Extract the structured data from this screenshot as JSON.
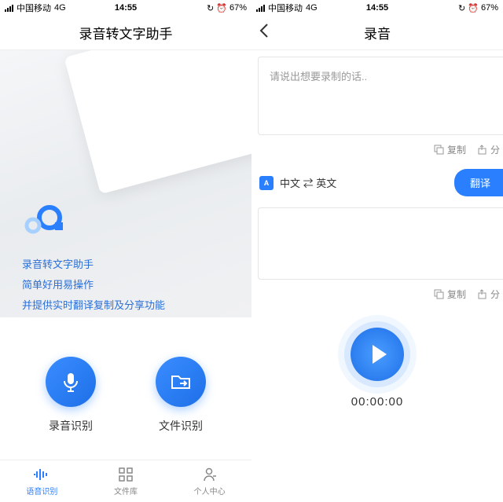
{
  "status": {
    "carrier": "中国移动",
    "network": "4G",
    "time": "14:55",
    "battery": "67%"
  },
  "screen1": {
    "title": "录音转文字助手",
    "hero_line1": "录音转文字助手",
    "hero_line2": "简单好用易操作",
    "hero_line3": "并提供实时翻译复制及分享功能",
    "action1_label": "录音识别",
    "action2_label": "文件识别",
    "tabs": [
      {
        "label": "语音识别",
        "active": true
      },
      {
        "label": "文件库",
        "active": false
      },
      {
        "label": "个人中心",
        "active": false
      }
    ]
  },
  "screen2": {
    "title": "录音",
    "placeholder": "请说出想要录制的话..",
    "copy_label": "复制",
    "share_label": "分",
    "lang_pair": "中文 ⇄ 英文",
    "translate_btn": "翻译",
    "timer": "00:00:00"
  }
}
